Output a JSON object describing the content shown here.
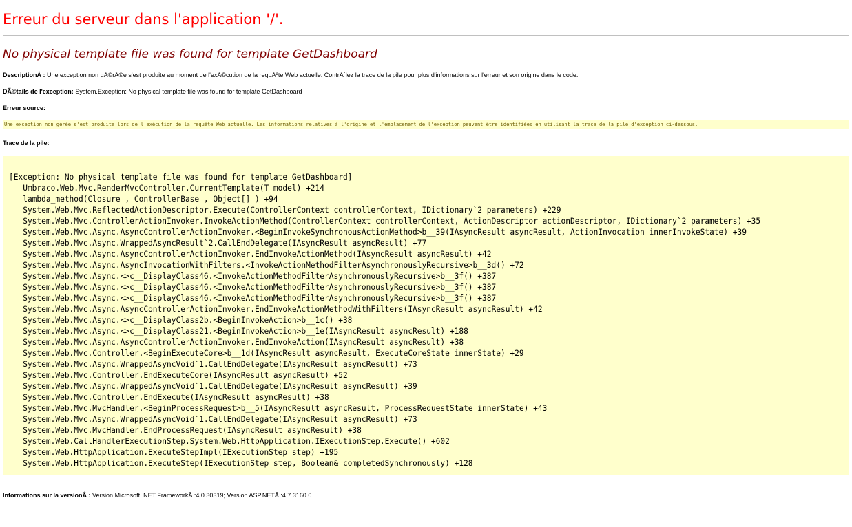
{
  "header": {
    "title": "Erreur du serveur dans l'application '/'.",
    "exception_title": "No physical template file was found for template GetDashboard"
  },
  "description": {
    "label": "DescriptionÂ :",
    "text": "Une exception non gÃ©rÃ©e s'est produite au moment de l'exÃ©cution de la requÃªte Web actuelle. ContrÃ´lez la trace de la pile pour plus d'informations sur l'erreur et son origine dans le code."
  },
  "exception_details": {
    "label": "DÃ©tails de l'exception:",
    "text": "System.Exception: No physical template file was found for template GetDashboard"
  },
  "source_error": {
    "label": "Erreur source:",
    "text": "Une exception non gérée s'est produite lors de l'exécution de la requête Web actuelle. Les informations relatives à l'origine et l'emplacement de l'exception peuvent être identifiées en utilisant la trace de la pile d'exception ci-dessous."
  },
  "stack_trace": {
    "label": "Trace de la pile:",
    "text": "[Exception: No physical template file was found for template GetDashboard]\n   Umbraco.Web.Mvc.RenderMvcController.CurrentTemplate(T model) +214\n   lambda_method(Closure , ControllerBase , Object[] ) +94\n   System.Web.Mvc.ReflectedActionDescriptor.Execute(ControllerContext controllerContext, IDictionary`2 parameters) +229\n   System.Web.Mvc.ControllerActionInvoker.InvokeActionMethod(ControllerContext controllerContext, ActionDescriptor actionDescriptor, IDictionary`2 parameters) +35\n   System.Web.Mvc.Async.AsyncControllerActionInvoker.<BeginInvokeSynchronousActionMethod>b__39(IAsyncResult asyncResult, ActionInvocation innerInvokeState) +39\n   System.Web.Mvc.Async.WrappedAsyncResult`2.CallEndDelegate(IAsyncResult asyncResult) +77\n   System.Web.Mvc.Async.AsyncControllerActionInvoker.EndInvokeActionMethod(IAsyncResult asyncResult) +42\n   System.Web.Mvc.Async.AsyncInvocationWithFilters.<InvokeActionMethodFilterAsynchronouslyRecursive>b__3d() +72\n   System.Web.Mvc.Async.<>c__DisplayClass46.<InvokeActionMethodFilterAsynchronouslyRecursive>b__3f() +387\n   System.Web.Mvc.Async.<>c__DisplayClass46.<InvokeActionMethodFilterAsynchronouslyRecursive>b__3f() +387\n   System.Web.Mvc.Async.<>c__DisplayClass46.<InvokeActionMethodFilterAsynchronouslyRecursive>b__3f() +387\n   System.Web.Mvc.Async.AsyncControllerActionInvoker.EndInvokeActionMethodWithFilters(IAsyncResult asyncResult) +42\n   System.Web.Mvc.Async.<>c__DisplayClass2b.<BeginInvokeAction>b__1c() +38\n   System.Web.Mvc.Async.<>c__DisplayClass21.<BeginInvokeAction>b__1e(IAsyncResult asyncResult) +188\n   System.Web.Mvc.Async.AsyncControllerActionInvoker.EndInvokeAction(IAsyncResult asyncResult) +38\n   System.Web.Mvc.Controller.<BeginExecuteCore>b__1d(IAsyncResult asyncResult, ExecuteCoreState innerState) +29\n   System.Web.Mvc.Async.WrappedAsyncVoid`1.CallEndDelegate(IAsyncResult asyncResult) +73\n   System.Web.Mvc.Controller.EndExecuteCore(IAsyncResult asyncResult) +52\n   System.Web.Mvc.Async.WrappedAsyncVoid`1.CallEndDelegate(IAsyncResult asyncResult) +39\n   System.Web.Mvc.Controller.EndExecute(IAsyncResult asyncResult) +38\n   System.Web.Mvc.MvcHandler.<BeginProcessRequest>b__5(IAsyncResult asyncResult, ProcessRequestState innerState) +43\n   System.Web.Mvc.Async.WrappedAsyncVoid`1.CallEndDelegate(IAsyncResult asyncResult) +73\n   System.Web.Mvc.MvcHandler.EndProcessRequest(IAsyncResult asyncResult) +38\n   System.Web.CallHandlerExecutionStep.System.Web.HttpApplication.IExecutionStep.Execute() +602\n   System.Web.HttpApplication.ExecuteStepImpl(IExecutionStep step) +195\n   System.Web.HttpApplication.ExecuteStep(IExecutionStep step, Boolean& completedSynchronously) +128"
  },
  "version_info": {
    "label": "Informations sur la versionÂ :",
    "text": "Version Microsoft .NET FrameworkÂ :4.0.30319; Version ASP.NETÂ :4.7.3160.0"
  },
  "colors": {
    "title_red": "#ff0000",
    "exception_maroon": "#800000",
    "code_background": "#ffffcc"
  }
}
